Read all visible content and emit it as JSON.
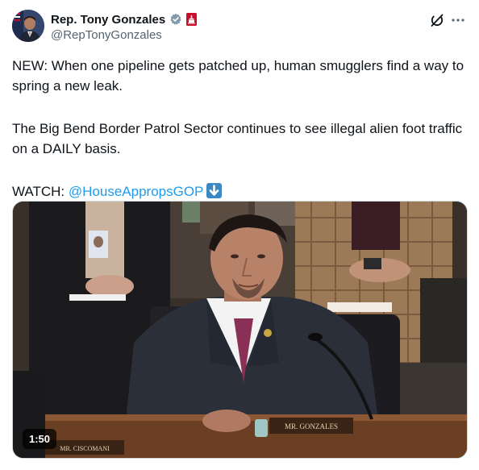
{
  "author": {
    "display_name": "Rep. Tony Gonzales",
    "handle": "@RepTonyGonzales",
    "verified_icon": "verified-badge-icon",
    "affiliation_icon": "us-government-badge-icon",
    "colors": {
      "verified": "#829aab",
      "affiliation": "#c8102e"
    }
  },
  "actions": {
    "grok_icon": "grok-icon",
    "more_icon": "more-options-icon"
  },
  "tweet": {
    "paragraph1": "NEW: When one pipeline gets patched up, human smugglers find a way to spring a new leak.",
    "paragraph2": "The Big Bend Border Patrol Sector continues to see illegal alien foot traffic on a DAILY basis.",
    "watch_prefix": "WATCH: ",
    "mention": "@HouseAppropsGOP",
    "emoji_icon": "down-arrow-emoji-icon",
    "colors": {
      "link": "#1d9bf0",
      "text": "#0f1419"
    }
  },
  "media": {
    "type": "video",
    "duration": "1:50",
    "nameplate_main": "MR. GONZALES",
    "nameplate_left": "MR. CISCOMANI"
  }
}
